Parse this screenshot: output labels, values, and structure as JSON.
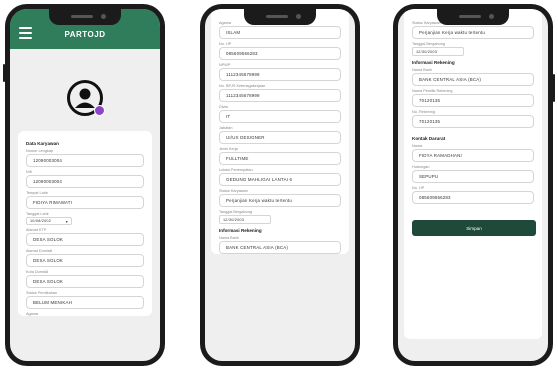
{
  "screen1": {
    "app_title": "PARTOJD",
    "section_title": "Data Karyawan",
    "fields": [
      {
        "label": "Nomor Lengkap",
        "value": "12090003004"
      },
      {
        "label": "NIK",
        "value": "12090003004"
      },
      {
        "label": "Tempat Lahir",
        "value": "FIDIYA RIMAWATI"
      }
    ],
    "dob": {
      "label": "Tanggal Lahir",
      "value": "10/08/2002"
    },
    "fields2": [
      {
        "label": "Alamat KTP",
        "value": "DESA SOLOK"
      },
      {
        "label": "Alamat Domisili",
        "value": "DESA SOLOK"
      },
      {
        "label": "Kota Domisili",
        "value": "DESA SOLOK"
      },
      {
        "label": "Status Pernikahan",
        "value": "BELUM MENIKAH"
      }
    ],
    "trailing_label": "Agama"
  },
  "screen2": {
    "top_label": "Agama",
    "fields": [
      {
        "label": "",
        "value": "ISLAM"
      },
      {
        "label": "No. HP",
        "value": "085609556283"
      },
      {
        "label": "NPWP",
        "value": "1112345678999"
      },
      {
        "label": "No. BPJS Ketenagakerjaan",
        "value": "1112345678999"
      },
      {
        "label": "Divisi",
        "value": "IT"
      },
      {
        "label": "Jabatan",
        "value": "UI/UX DESIGNER"
      },
      {
        "label": "Jenis Kerja",
        "value": "FULLTIME"
      },
      {
        "label": "Lokasi Penempatan",
        "value": "GEDUNG MAHLIGAI LANTAI 6"
      },
      {
        "label": "Status Karyawan",
        "value": "Perjanjian Kerja waktu tertentu"
      }
    ],
    "date": {
      "label": "Tanggal Bergabung",
      "value": "12/30/2003"
    },
    "section_title": "Informasi Rekening",
    "bank": {
      "label": "Nama Bank",
      "value": "BANK CENTRAL ASIA (BCA)"
    }
  },
  "screen3": {
    "top_label": "Status Karyawan",
    "status_value": "Perjanjian Kerja waktu tertentu",
    "date": {
      "label": "Tanggal Bergabung",
      "value": "12/30/2003"
    },
    "section1_title": "Informasi Rekening",
    "fields1": [
      {
        "label": "Nama Bank",
        "value": "BANK CENTRAL ASIA (BCA)"
      },
      {
        "label": "Nama Pemilik Rekening",
        "value": "70120135"
      },
      {
        "label": "No. Rekening",
        "value": "70120135"
      }
    ],
    "section2_title": "Kontak Darurat",
    "fields2": [
      {
        "label": "Nama",
        "value": "FIDYA RAMADHANI"
      },
      {
        "label": "Hubungan",
        "value": "SEPUPU"
      },
      {
        "label": "No. HP",
        "value": "085609556283"
      }
    ],
    "save_label": "Simpan"
  },
  "colors": {
    "accent": "#2f7d5b",
    "button": "#1f4a3a",
    "badge": "#8e44c9"
  },
  "icons": [
    "menu-icon",
    "user-avatar-icon",
    "edit-badge-icon",
    "caret-down-icon"
  ]
}
